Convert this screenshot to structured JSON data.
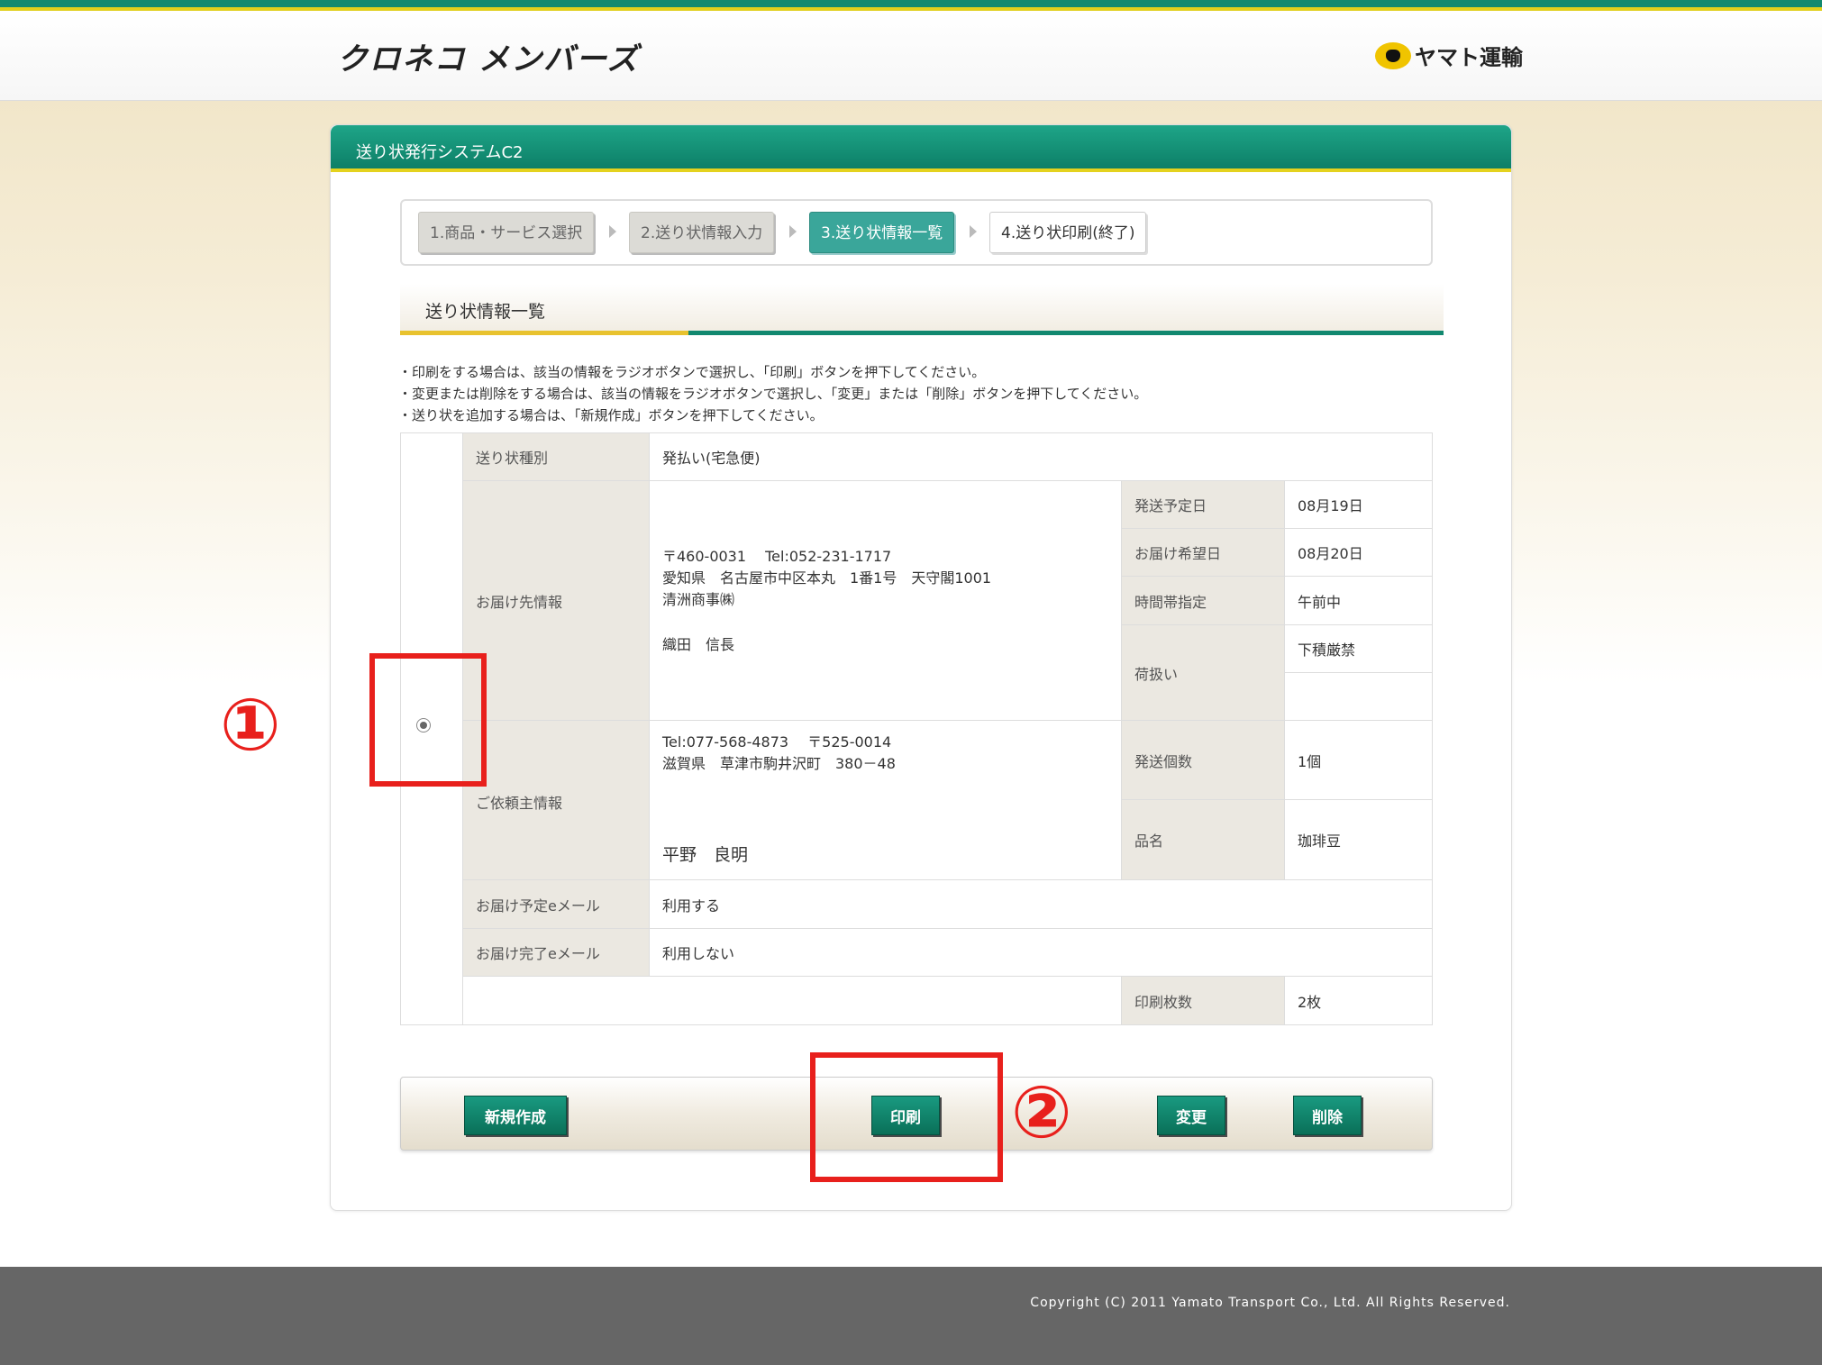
{
  "header": {
    "site_logo": "クロネコ メンバーズ",
    "corp_logo": "ヤマト運輸"
  },
  "panel": {
    "system_title": "送り状発行システムC2"
  },
  "steps": [
    {
      "label": "1.商品・サービス選択",
      "state": "done"
    },
    {
      "label": "2.送り状情報入力",
      "state": "done"
    },
    {
      "label": "3.送り状情報一覧",
      "state": "active"
    },
    {
      "label": "4.送り状印刷(終了)",
      "state": "pending"
    }
  ],
  "section": {
    "title": "送り状情報一覧"
  },
  "instructions": [
    "・印刷をする場合は、該当の情報をラジオボタンで選択し、「印刷」ボタンを押下してください。",
    "・変更または削除をする場合は、該当の情報をラジオボタンで選択し、「変更」または「削除」ボタンを押下してください。",
    "・送り状を追加する場合は、「新規作成」ボタンを押下してください。"
  ],
  "table": {
    "invoice_type_label": "送り状種別",
    "invoice_type_value": "発払い(宅急便)",
    "recipient_label": "お届け先情報",
    "recipient_postal_tel": "〒460-0031　 Tel:052-231-1717",
    "recipient_address": "愛知県　名古屋市中区本丸　1番1号　天守閣1001",
    "recipient_company": "清洲商事㈱",
    "recipient_name": "織田　信長",
    "ship_date_label": "発送予定日",
    "ship_date_value": "08月19日",
    "delivery_date_label": "お届け希望日",
    "delivery_date_value": "08月20日",
    "time_slot_label": "時間帯指定",
    "time_slot_value": "午前中",
    "handling_label": "荷扱い",
    "handling_value_1": "下積厳禁",
    "handling_value_2": "",
    "sender_label": "ご依頼主情報",
    "sender_tel_postal": "Tel:077-568-4873　 〒525-0014",
    "sender_address": "滋賀県　草津市駒井沢町　380－48",
    "sender_name": "平野　良明",
    "package_count_label": "発送個数",
    "package_count_value": "1個",
    "item_name_label": "品名",
    "item_name_value": "珈琲豆",
    "scheduled_email_label": "お届け予定eメール",
    "scheduled_email_value": "利用する",
    "completed_email_label": "お届け完了eメール",
    "completed_email_value": "利用しない",
    "print_count_label": "印刷枚数",
    "print_count_value": "2枚"
  },
  "buttons": {
    "new": "新規作成",
    "print": "印刷",
    "change": "変更",
    "delete": "削除"
  },
  "annotations": {
    "marker_1": "①",
    "marker_2": "②",
    "color": "#e8201c"
  },
  "footer": {
    "copyright": "Copyright (C) 2011 Yamato Transport Co., Ltd. All Rights Reserved."
  },
  "colors": {
    "brand_green": "#12896f",
    "accent_yellow": "#e0cf1c",
    "active_step": "#3aa69a"
  }
}
